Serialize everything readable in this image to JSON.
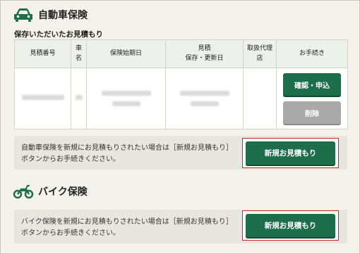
{
  "car_section": {
    "title": "自動車保険",
    "subtitle": "保存いただいたお見積もり",
    "table": {
      "headers": [
        "見積番号",
        "車名",
        "保険始期日",
        "見積保存・更新日",
        "取扱代理店",
        "お手続き"
      ],
      "header_lines": {
        "car": [
          "車",
          "名"
        ],
        "saved": [
          "見積",
          "保存・更新日"
        ],
        "agent": [
          "取扱代理",
          "店"
        ]
      },
      "confirm_button": "確認・申込",
      "delete_button": "削除"
    },
    "notice": {
      "text": "自動車保険を新規にお見積もりされたい場合は［新規お見積もり］ボタンからお手続きください。",
      "button": "新規お見積もり"
    }
  },
  "bike_section": {
    "title": "バイク保険",
    "notice": {
      "text": "バイク保険を新規にお見積もりされたい場合は［新規お見積もり］ボタンからお手続きください。",
      "button": "新規お見積もり"
    }
  },
  "colors": {
    "accent_green": "#1d6f4c",
    "delete_gray": "#a9a9a9",
    "highlight_red": "#cc2222",
    "background": "#f4f2eb"
  },
  "icons": {
    "car": "car-icon",
    "bike": "motorcycle-icon"
  }
}
